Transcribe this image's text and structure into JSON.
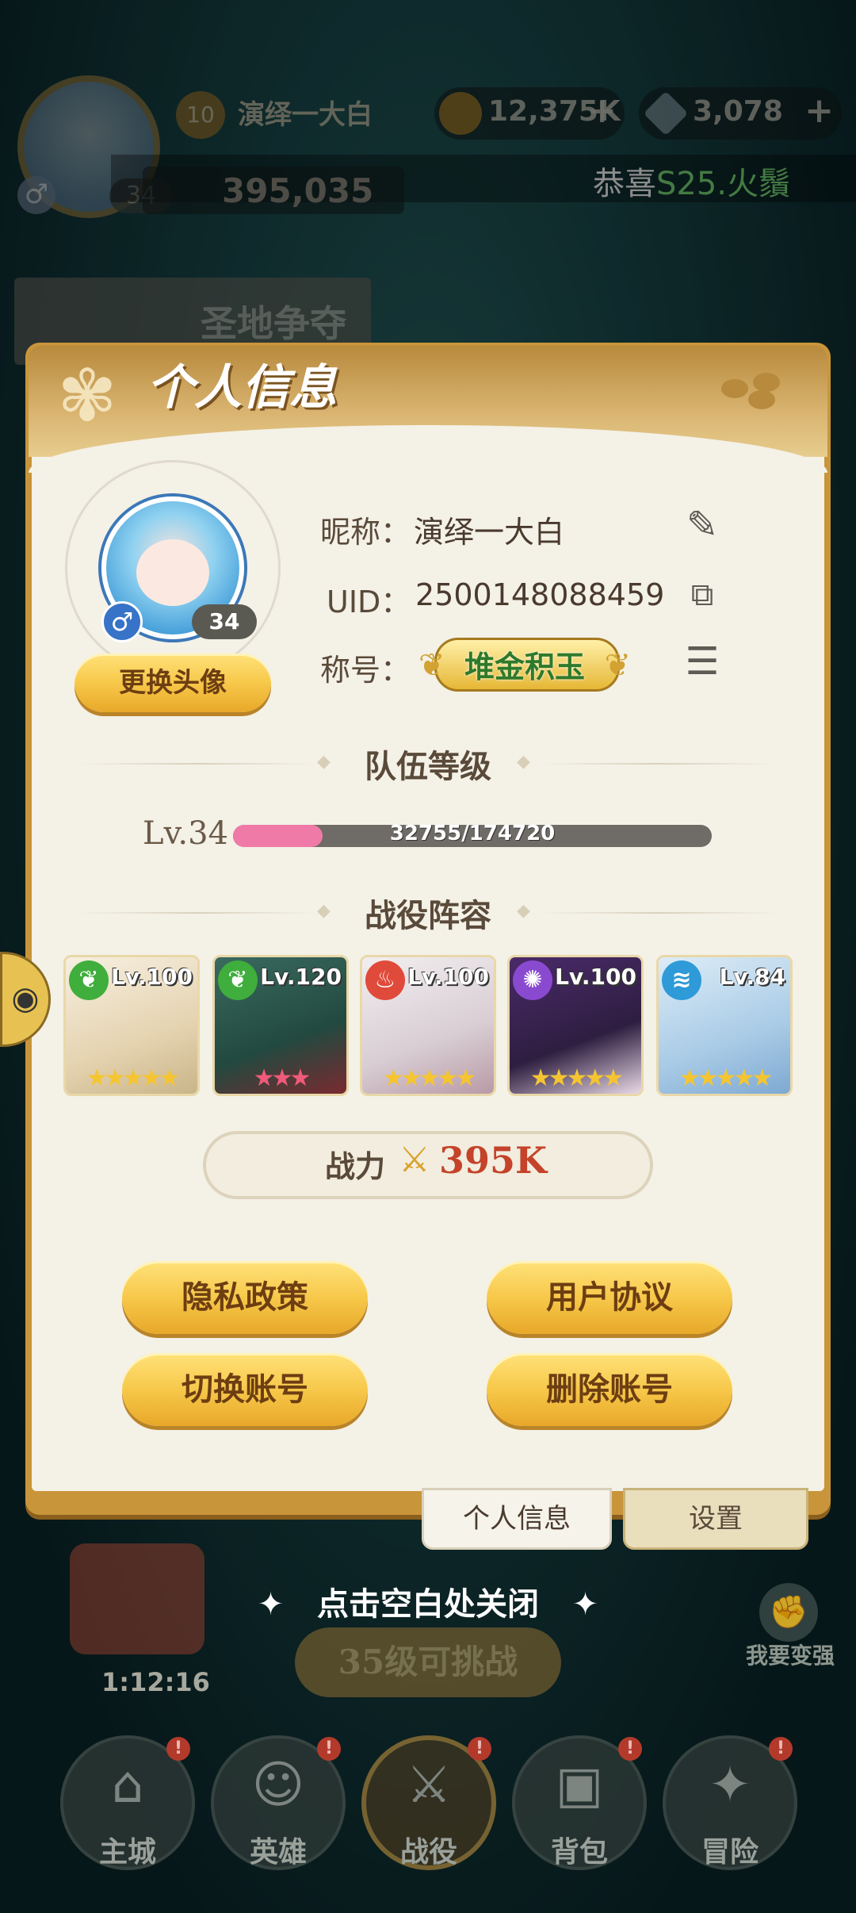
{
  "hud": {
    "player_level": "10",
    "player_name": "演绎一大白",
    "gold": "12,375K",
    "gems": "3,078",
    "avatar_level": "34",
    "power": "395,035",
    "gender_symbol": "♂",
    "marquee_prefix": "恭喜",
    "marquee_highlight": "S25.火鬚",
    "event_label": "圣地争夺"
  },
  "panel": {
    "title": "个人信息",
    "avatar": {
      "gender_symbol": "♂",
      "level": "34",
      "change_button": "更换头像"
    },
    "nickname_label": "昵称：",
    "nickname_value": "演绎一大白",
    "uid_label": "UID：",
    "uid_value": "2500148088459",
    "title_label": "称号：",
    "title_badge": "堆金积玉",
    "team_level_header": "队伍等级",
    "team_level": {
      "label": "Lv.34",
      "xp_current": 32755,
      "xp_max": 174720,
      "xp_text": "32755/174720"
    },
    "lineup_header": "战役阵容",
    "heroes": [
      {
        "level": "Lv.100",
        "element": "leaf",
        "stars": 5,
        "star_color": "#f5c531"
      },
      {
        "level": "Lv.120",
        "element": "leaf",
        "stars": 3,
        "star_color": "#f05a7a"
      },
      {
        "level": "Lv.100",
        "element": "fire",
        "stars": 5,
        "star_color": "#f5c531"
      },
      {
        "level": "Lv.100",
        "element": "arcane",
        "stars": 5,
        "star_color": "#f5c531"
      },
      {
        "level": "Lv.84",
        "element": "water",
        "stars": 5,
        "star_color": "#f5c531"
      }
    ],
    "power_label": "战力",
    "power_value": "395K",
    "buttons": {
      "privacy": "隐私政策",
      "agreement": "用户协议",
      "switch": "切换账号",
      "delete": "删除账号"
    },
    "tabs": {
      "info": "个人信息",
      "settings": "设置"
    }
  },
  "close_hint": "点击空白处关闭",
  "scene": {
    "timer": "1:12:16",
    "challenge": "35级可挑战",
    "stronger": "我要变强"
  },
  "bottom_nav": [
    {
      "label": "主城",
      "badge": "!"
    },
    {
      "label": "英雄",
      "badge": "!"
    },
    {
      "label": "战役",
      "badge": "!"
    },
    {
      "label": "背包",
      "badge": "!"
    },
    {
      "label": "冒险",
      "badge": "!"
    }
  ],
  "colors": {
    "accent_gold": "#f7c84a",
    "xp_fill": "#f07aa7",
    "power_red": "#c4432a",
    "leaf": "#3fae3c",
    "fire": "#e04a3a",
    "arcane": "#8a4ad0",
    "water": "#2e9ad8"
  }
}
